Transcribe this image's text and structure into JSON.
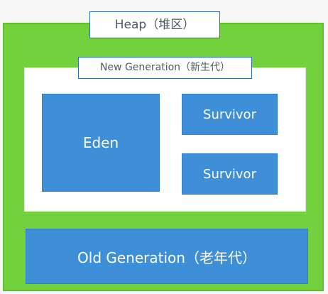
{
  "diagram": {
    "heap_label": "Heap（堆区）",
    "new_generation_label": "New Generation（新生代）",
    "eden_label": "Eden",
    "survivor_1_label": "Survivor",
    "survivor_2_label": "Survivor",
    "old_generation_label": "Old Generation（老年代）"
  },
  "colors": {
    "heap_green": "#72d13d",
    "block_blue": "#3f8fd8",
    "label_border": "#2e6fb3"
  }
}
